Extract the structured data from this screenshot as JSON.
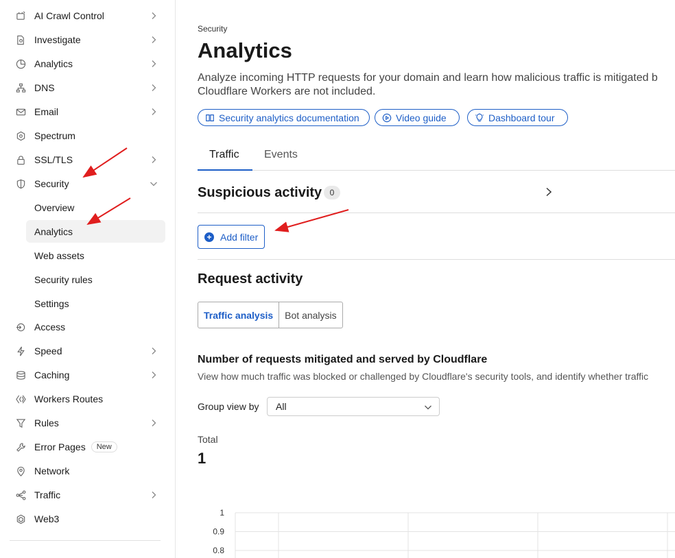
{
  "sidebar": {
    "items": [
      {
        "label": "AI Crawl Control",
        "icon": "ai-crawl-icon",
        "chevron": true
      },
      {
        "label": "Investigate",
        "icon": "investigate-icon",
        "chevron": true
      },
      {
        "label": "Analytics",
        "icon": "analytics-icon",
        "chevron": true
      },
      {
        "label": "DNS",
        "icon": "dns-icon",
        "chevron": true
      },
      {
        "label": "Email",
        "icon": "email-icon",
        "chevron": true
      },
      {
        "label": "Spectrum",
        "icon": "spectrum-icon",
        "chevron": false
      },
      {
        "label": "SSL/TLS",
        "icon": "lock-icon",
        "chevron": true
      },
      {
        "label": "Security",
        "icon": "shield-icon",
        "chevron": "down"
      }
    ],
    "security_sub": [
      {
        "label": "Overview"
      },
      {
        "label": "Analytics",
        "active": true
      },
      {
        "label": "Web assets"
      },
      {
        "label": "Security rules"
      },
      {
        "label": "Settings"
      }
    ],
    "items_after": [
      {
        "label": "Access",
        "icon": "access-icon",
        "chevron": false
      },
      {
        "label": "Speed",
        "icon": "bolt-icon",
        "chevron": true
      },
      {
        "label": "Caching",
        "icon": "caching-icon",
        "chevron": true
      },
      {
        "label": "Workers Routes",
        "icon": "workers-icon",
        "chevron": false
      },
      {
        "label": "Rules",
        "icon": "rules-icon",
        "chevron": true
      },
      {
        "label": "Error Pages",
        "icon": "wrench-icon",
        "chevron": false,
        "badge": "New"
      },
      {
        "label": "Network",
        "icon": "location-pin-icon",
        "chevron": false
      },
      {
        "label": "Traffic",
        "icon": "traffic-icon",
        "chevron": true
      },
      {
        "label": "Web3",
        "icon": "web3-icon",
        "chevron": false
      }
    ]
  },
  "header": {
    "breadcrumb": "Security",
    "title": "Analytics",
    "description_line1": "Analyze incoming HTTP requests for your domain and learn how malicious traffic is mitigated b",
    "description_line2": "Cloudflare Workers are not included."
  },
  "links": {
    "docs": "Security analytics documentation",
    "video": "Video guide",
    "tour": "Dashboard tour"
  },
  "tabs": [
    {
      "label": "Traffic",
      "active": true
    },
    {
      "label": "Events",
      "active": false
    }
  ],
  "suspicious": {
    "title": "Suspicious activity",
    "count": "0"
  },
  "filter": {
    "add_label": "Add filter"
  },
  "request_activity": {
    "title": "Request activity",
    "segments": [
      "Traffic analysis",
      "Bot analysis"
    ]
  },
  "chart_section": {
    "title": "Number of requests mitigated and served by Cloudflare",
    "description": "View how much traffic was blocked or challenged by Cloudflare's security tools, and identify whether traffic",
    "group_label": "Group view by",
    "group_value": "All",
    "total_label": "Total",
    "total_value": "1"
  },
  "chart_data": {
    "type": "line",
    "y_ticks": [
      "1",
      "0.9",
      "0.8"
    ],
    "ylim": [
      0.8,
      1
    ],
    "grid": true
  },
  "colors": {
    "accent": "#1d5ec7",
    "annotation_arrow": "#e01e1e"
  }
}
